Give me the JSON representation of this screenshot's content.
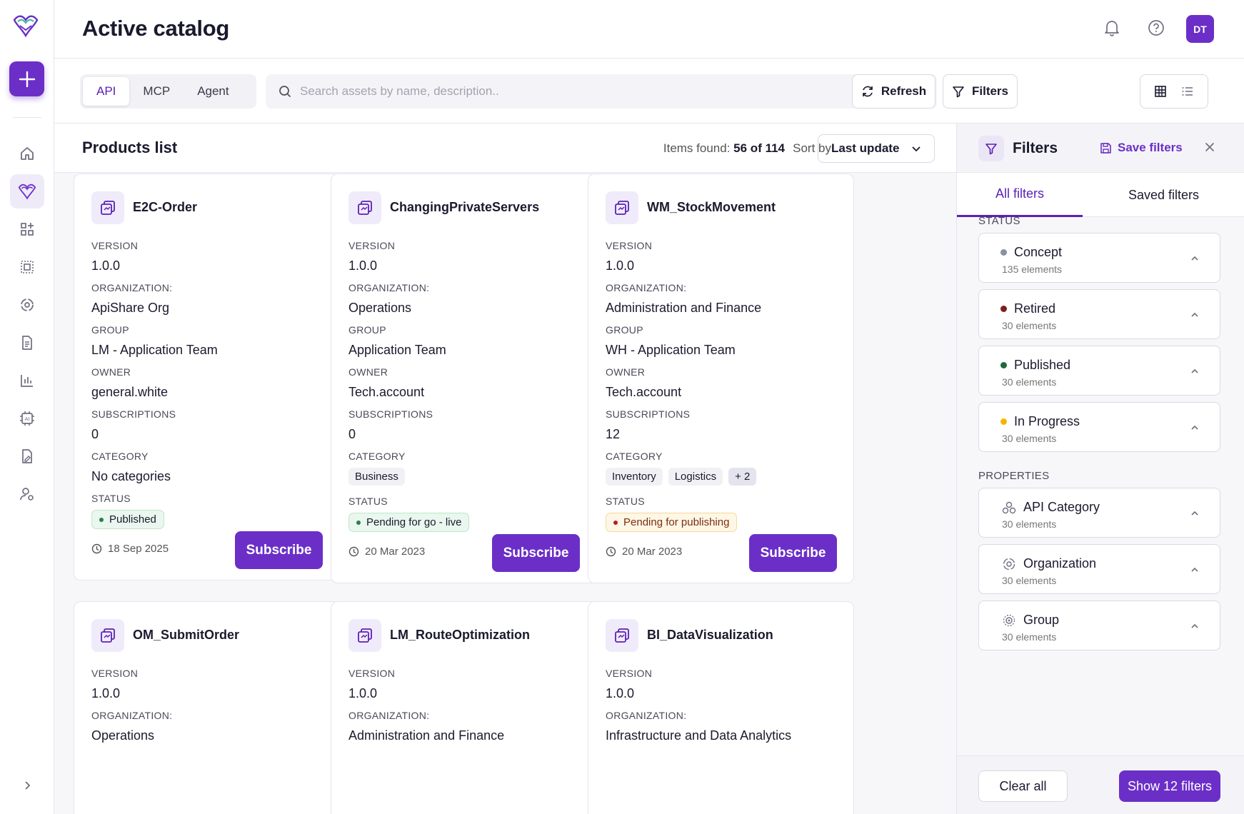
{
  "header": {
    "title": "Active catalog",
    "avatar_initials": "DT"
  },
  "toolbar": {
    "tabs": [
      {
        "label": "API",
        "active": true
      },
      {
        "label": "MCP"
      },
      {
        "label": "Agent"
      }
    ],
    "search_placeholder": "Search assets by name, description..",
    "refresh_label": "Refresh",
    "filters_label": "Filters"
  },
  "list": {
    "title": "Products list",
    "items_found_label": "Items found:",
    "items_found_value": "56 of 114",
    "sort_label": "Sort by",
    "sort_value": "Last update"
  },
  "labels": {
    "version": "VERSION",
    "organization": "ORGANIZATION:",
    "group": "GROUP",
    "owner": "OWNER",
    "subscriptions": "SUBSCRIPTIONS",
    "category": "CATEGORY",
    "status": "STATUS",
    "subscribe": "Subscribe"
  },
  "cards": [
    {
      "name": "E2C-Order",
      "version": "1.0.0",
      "organization": "ApiShare Org",
      "group": "LM - Application Team",
      "owner": "general.white",
      "subscriptions": "0",
      "category_text": "No categories",
      "status": "Published",
      "date": "18 Sep 2025"
    },
    {
      "name": "ChangingPrivateServers",
      "version": "1.0.0",
      "organization": "Operations",
      "group": "Application Team",
      "owner": "Tech.account",
      "subscriptions": "0",
      "categories": [
        "Business"
      ],
      "status": "Pending for go - live",
      "date": "20 Mar 2023"
    },
    {
      "name": "WM_StockMovement",
      "version": "1.0.0",
      "organization": "Administration and Finance",
      "group": "WH - Application Team",
      "owner": "Tech.account",
      "subscriptions": "12",
      "categories": [
        "Inventory",
        "Logistics"
      ],
      "categories_more": "+ 2",
      "status": "Pending for publishing",
      "date": "20 Mar 2023"
    },
    {
      "name": "OM_SubmitOrder",
      "version": "1.0.0",
      "organization": "Operations"
    },
    {
      "name": "LM_RouteOptimization",
      "version": "1.0.0",
      "organization": "Administration and Finance"
    },
    {
      "name": "BI_DataVisualization",
      "version": "1.0.0",
      "organization": "Infrastructure and Data Analytics"
    }
  ],
  "status_colors": {
    "published": "#2e7d4f",
    "golive": "#2e7d4f",
    "publishing": "#b91c1c"
  },
  "filter_panel": {
    "title": "Filters",
    "save_label": "Save filters",
    "tabs": [
      "All filters",
      "Saved filters"
    ],
    "status_section": "STATUS",
    "status_items": [
      {
        "label": "Concept",
        "count": "135 elements",
        "color": "#8a8fa3"
      },
      {
        "label": "Retired",
        "count": "30 elements",
        "color": "#7a1f1f"
      },
      {
        "label": "Published",
        "count": "30 elements",
        "color": "#1e6b3a"
      },
      {
        "label": "In Progress",
        "count": "30 elements",
        "color": "#f5b400"
      }
    ],
    "properties_section": "PROPERTIES",
    "property_items": [
      {
        "label": "API Category",
        "count": "30 elements",
        "icon": "category-icon"
      },
      {
        "label": "Organization",
        "count": "30 elements",
        "icon": "organization-icon"
      },
      {
        "label": "Group",
        "count": "30 elements",
        "icon": "group-icon"
      }
    ],
    "clear_label": "Clear all",
    "show_label": "Show 12 filters"
  },
  "accent": "#6b2fc7"
}
